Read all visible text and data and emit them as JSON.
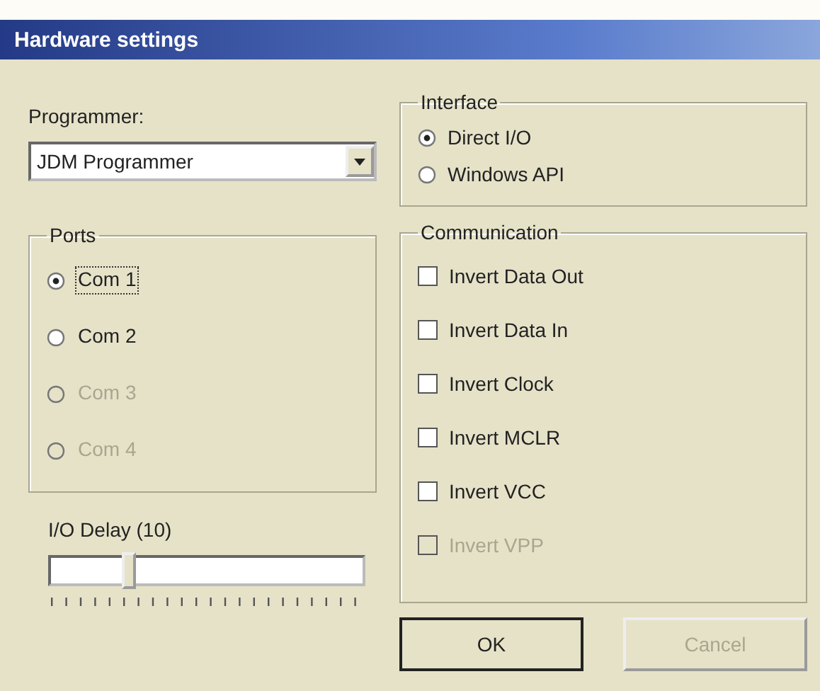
{
  "window": {
    "title": "Hardware settings"
  },
  "programmer": {
    "label": "Programmer:",
    "value": "JDM Programmer"
  },
  "ports": {
    "title": "Ports",
    "options": [
      {
        "label": "Com 1",
        "selected": true,
        "disabled": false,
        "focused": true
      },
      {
        "label": "Com 2",
        "selected": false,
        "disabled": false,
        "focused": false
      },
      {
        "label": "Com 3",
        "selected": false,
        "disabled": true,
        "focused": false
      },
      {
        "label": "Com 4",
        "selected": false,
        "disabled": true,
        "focused": false
      }
    ]
  },
  "io_delay": {
    "label": "I/O Delay (10)",
    "level": 0.25
  },
  "interface": {
    "title": "Interface",
    "options": [
      {
        "label": "Direct I/O",
        "selected": true
      },
      {
        "label": "Windows API",
        "selected": false
      }
    ]
  },
  "communication": {
    "title": "Communication",
    "options": [
      {
        "label": "Invert Data Out",
        "checked": false,
        "disabled": false
      },
      {
        "label": "Invert Data In",
        "checked": false,
        "disabled": false
      },
      {
        "label": "Invert Clock",
        "checked": false,
        "disabled": false
      },
      {
        "label": "Invert MCLR",
        "checked": false,
        "disabled": false
      },
      {
        "label": "Invert VCC",
        "checked": false,
        "disabled": false
      },
      {
        "label": "Invert VPP",
        "checked": false,
        "disabled": true
      }
    ]
  },
  "buttons": [
    {
      "label": "OK",
      "disabled": false,
      "default": true
    },
    {
      "label": "Cancel",
      "disabled": true,
      "default": false
    }
  ]
}
